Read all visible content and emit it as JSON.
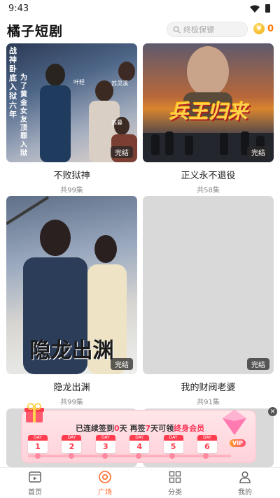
{
  "status_bar": {
    "time": "9:43"
  },
  "header": {
    "title": "橘子短剧",
    "search_placeholder": "终极保镖",
    "coin_count": "0"
  },
  "dramas": [
    {
      "title": "不败狱神",
      "episodes": "共99集",
      "badge": "完结",
      "poster_text": [
        "战神卧底入狱六年",
        "为了黄金女友顶罪入狱",
        "叶轻",
        "苏灵溪",
        "苏暮"
      ]
    },
    {
      "title": "正义永不退役",
      "episodes": "共58集",
      "badge": "完结",
      "poster_text": [
        "兵王归来"
      ]
    },
    {
      "title": "隐龙出渊",
      "episodes": "共99集",
      "badge": "完结",
      "poster_text": [
        "隐龙出渊"
      ]
    },
    {
      "title": "我的财阀老婆",
      "episodes": "共91集",
      "badge": "完结",
      "poster_text": []
    }
  ],
  "checkin": {
    "text_prefix": "已连续签到",
    "streak_days": "0",
    "text_mid1": "天 再签",
    "remaining_days": "7",
    "text_mid2": "天可领",
    "reward": "终身会员",
    "day_header": "DAY",
    "days": [
      "1",
      "2",
      "3",
      "4",
      "5",
      "6"
    ],
    "vip_label": "VIP",
    "close_icon": "close-icon"
  },
  "bottom_nav": [
    {
      "label": "首页",
      "icon": "video-icon",
      "active": false
    },
    {
      "label": "广场",
      "icon": "disc-icon",
      "active": true
    },
    {
      "label": "分类",
      "icon": "grid-icon",
      "active": false
    },
    {
      "label": "我的",
      "icon": "user-icon",
      "active": false
    }
  ],
  "colors": {
    "accent": "#ff6a2a",
    "coin": "#ff7a00",
    "checkin_red": "#ff3d4f"
  }
}
